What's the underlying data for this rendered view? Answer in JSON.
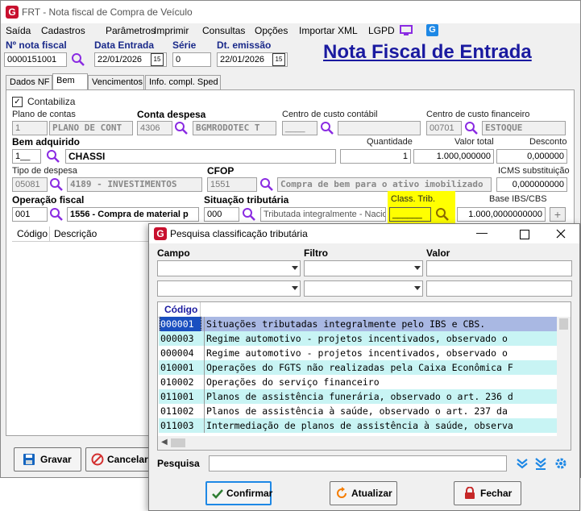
{
  "window": {
    "title": "FRT - Nota fiscal de Compra de Veículo"
  },
  "menu": [
    "Saída",
    "Cadastros",
    "Parâmetros",
    "Imprimir",
    "Consultas",
    "Opções",
    "Importar XML",
    "LGPD"
  ],
  "header": {
    "nf_label": "Nº nota fiscal",
    "nf_value": "0000151001",
    "data_entrada_label": "Data Entrada",
    "data_entrada_value": "22/01/2026",
    "serie_label": "Série",
    "serie_value": "0",
    "dt_emissao_label": "Dt. emissão",
    "dt_emissao_value": "22/01/2026",
    "page_title": "Nota Fiscal de Entrada",
    "calendar_glyph": "15"
  },
  "tabs": [
    "Dados NF",
    "Bem",
    "Vencimentos",
    "Info. compl. Sped"
  ],
  "form": {
    "contabiliza_label": "Contabiliza",
    "plano_label": "Plano de contas",
    "plano_code": "1",
    "plano_name": "PLANO DE CONT",
    "conta_label": "Conta despesa",
    "conta_code": "4306",
    "conta_name": "BGMRODOTEC T",
    "cc_contabil_label": "Centro de custo contábil",
    "cc_contabil_code": "____",
    "cc_fin_label": "Centro de custo financeiro",
    "cc_fin_code": "00701",
    "cc_fin_name": "ESTOQUE",
    "bem_label": "Bem adquirido",
    "bem_code": "1__",
    "bem_name": "CHASSI",
    "qtd_label": "Quantidade",
    "qtd_value": "1",
    "valor_label": "Valor total",
    "valor_value": "1.000,000000",
    "desconto_label": "Desconto",
    "desconto_value": "0,000000",
    "tipo_label": "Tipo de despesa",
    "tipo_code": "05081",
    "tipo_name": "4189 - INVESTIMENTOS",
    "cfop_label": "CFOP",
    "cfop_code": "1551",
    "cfop_name": "Compra de bem para o ativo imobilizado",
    "icms_label": "ICMS substituição",
    "icms_value": "0,000000000",
    "op_fiscal_label": "Operação fiscal",
    "op_fiscal_code": "001",
    "op_fiscal_name": "1556 - Compra de material p",
    "sit_trib_label": "Situação tributária",
    "sit_trib_code": "000",
    "sit_trib_name": "Tributada integralmente - Nacior",
    "class_trib_label": "Class. Trib.",
    "class_trib_value": "______",
    "base_label": "Base IBS/CBS",
    "base_value": "1.000,0000000000",
    "plus": "+"
  },
  "grid": {
    "col_codigo": "Código",
    "col_descricao": "Descrição"
  },
  "buttons": {
    "gravar": "Gravar",
    "cancelar": "Cancelar"
  },
  "dialog": {
    "title": "Pesquisa classificação tributária",
    "campo_label": "Campo",
    "filtro_label": "Filtro",
    "valor_label": "Valor",
    "col_codigo": "Código",
    "rows": [
      {
        "code": "000001",
        "desc": "Situações tributadas integralmente pelo IBS e CBS."
      },
      {
        "code": "000003",
        "desc": "Regime automotivo - projetos incentivados, observado o"
      },
      {
        "code": "000004",
        "desc": "Regime automotivo - projetos incentivados, observado o"
      },
      {
        "code": "010001",
        "desc": "Operações do FGTS não realizadas pela Caixa Econômica F"
      },
      {
        "code": "010002",
        "desc": "Operações do serviço financeiro"
      },
      {
        "code": "011001",
        "desc": "Planos de assistência funerária, observado o art. 236 d"
      },
      {
        "code": "011002",
        "desc": "Planos de assistência à saúde, observado o art. 237 da"
      },
      {
        "code": "011003",
        "desc": "Intermediação de planos de assistência à saúde, observa"
      }
    ],
    "pesquisa_label": "Pesquisa",
    "confirmar": "Confirmar",
    "atualizar": "Atualizar",
    "fechar": "Fechar"
  },
  "colors": {
    "accent": "#1a1aa0",
    "brand": "#c8102e",
    "highlight_row": "#a9b8e3",
    "cyan_row": "#c8f4f4",
    "yellow": "#ffff00"
  }
}
